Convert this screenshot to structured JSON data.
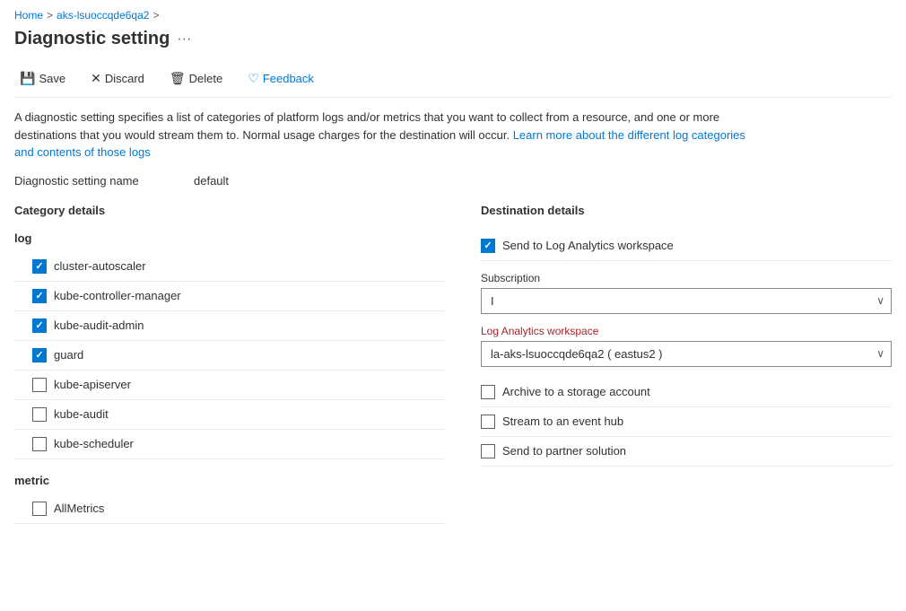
{
  "breadcrumb": {
    "home": "Home",
    "resource": "aks-lsuoccqde6qa2",
    "separator": ">"
  },
  "page": {
    "title": "Diagnostic setting",
    "ellipsis": "···"
  },
  "toolbar": {
    "save_label": "Save",
    "discard_label": "Discard",
    "delete_label": "Delete",
    "feedback_label": "Feedback",
    "save_icon": "💾",
    "discard_icon": "✕",
    "delete_icon": "🗑",
    "feedback_icon": "♡"
  },
  "description": {
    "text1": "A diagnostic setting specifies a list of categories of platform logs and/or metrics that you want to collect from a resource, and one or more destinations that you would stream them to. Normal usage charges for the destination will occur. ",
    "link_text": "Learn more about the different log categories and contents of those logs",
    "text2": ""
  },
  "setting_name": {
    "label": "Diagnostic setting name",
    "value": "default"
  },
  "category_details": {
    "title": "Category details",
    "log_group": {
      "label": "log",
      "items": [
        {
          "id": "cluster-autoscaler",
          "label": "cluster-autoscaler",
          "checked": true
        },
        {
          "id": "kube-controller-manager",
          "label": "kube-controller-manager",
          "checked": true
        },
        {
          "id": "kube-audit-admin",
          "label": "kube-audit-admin",
          "checked": true
        },
        {
          "id": "guard",
          "label": "guard",
          "checked": true
        },
        {
          "id": "kube-apiserver",
          "label": "kube-apiserver",
          "checked": false
        },
        {
          "id": "kube-audit",
          "label": "kube-audit",
          "checked": false
        },
        {
          "id": "kube-scheduler",
          "label": "kube-scheduler",
          "checked": false
        }
      ]
    },
    "metric_group": {
      "label": "metric",
      "items": [
        {
          "id": "AllMetrics",
          "label": "AllMetrics",
          "checked": false
        }
      ]
    }
  },
  "destination_details": {
    "title": "Destination details",
    "options": [
      {
        "id": "log-analytics",
        "label": "Send to Log Analytics workspace",
        "checked": true,
        "fields": [
          {
            "id": "subscription",
            "label": "Subscription",
            "required": false,
            "value": "I",
            "type": "select"
          },
          {
            "id": "workspace",
            "label": "Log Analytics workspace",
            "required": true,
            "value": "la-aks-lsuoccqde6qa2 ( eastus2 )",
            "type": "select"
          }
        ]
      },
      {
        "id": "storage-account",
        "label": "Archive to a storage account",
        "checked": false,
        "fields": []
      },
      {
        "id": "event-hub",
        "label": "Stream to an event hub",
        "checked": false,
        "fields": []
      },
      {
        "id": "partner-solution",
        "label": "Send to partner solution",
        "checked": false,
        "fields": []
      }
    ]
  }
}
